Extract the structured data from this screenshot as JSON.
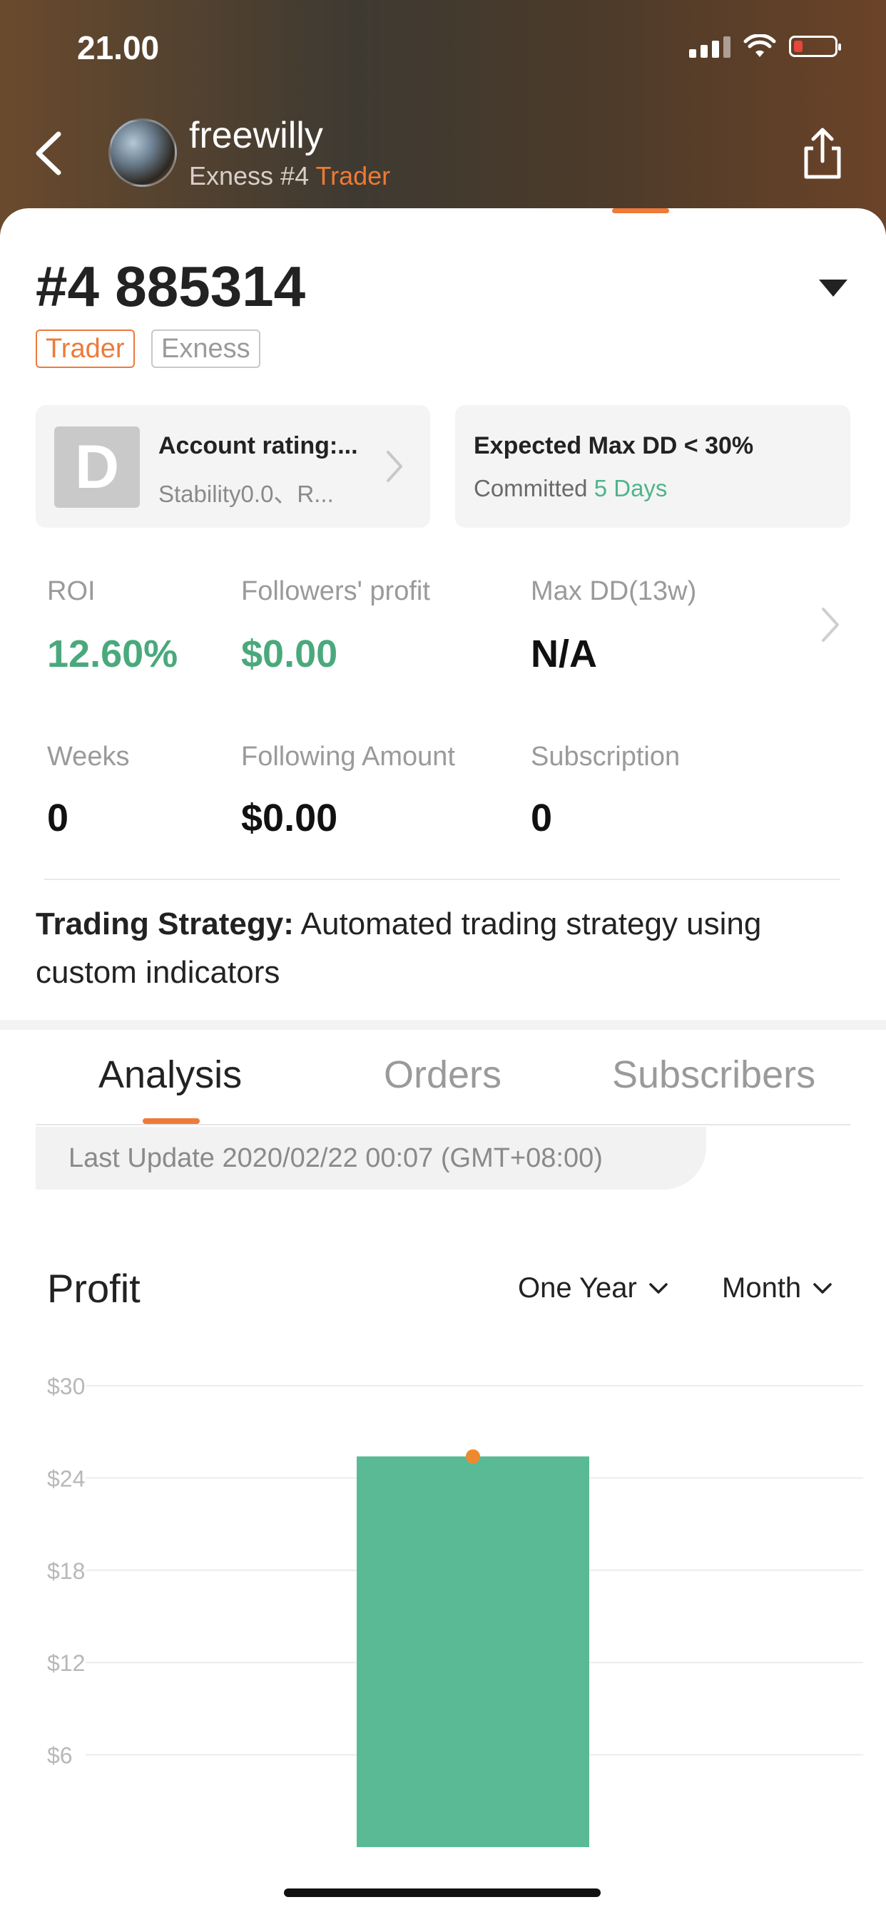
{
  "status": {
    "time": "21.00"
  },
  "header": {
    "username": "freewilly",
    "subtitle_prefix": "Exness #4",
    "subtitle_accent": "Trader",
    "accent_color": "#f07a33"
  },
  "account": {
    "title": "#4 885314",
    "tags": [
      "Trader",
      "Exness"
    ],
    "rating": {
      "logo_letter": "D",
      "title": "Account rating:...",
      "subtitle": "Stability0.0、R..."
    },
    "dd_card": {
      "title": "Expected Max DD < 30%",
      "committed_label": "Committed",
      "committed_value": "5 Days"
    }
  },
  "metrics": [
    {
      "label": "ROI",
      "value": "12.60%"
    },
    {
      "label": "Followers' profit",
      "value": "$0.00"
    },
    {
      "label": "Max DD(13w)",
      "value": "N/A"
    },
    {
      "label": "Weeks",
      "value": "0"
    },
    {
      "label": "Following Amount",
      "value": "$0.00"
    },
    {
      "label": "Subscription",
      "value": "0"
    }
  ],
  "strategy": {
    "label": "Trading Strategy:",
    "text": " Automated trading strategy using custom indicators"
  },
  "tabs": [
    "Analysis",
    "Orders",
    "Subscribers"
  ],
  "last_update": "Last Update 2020/02/22 00:07 (GMT+08:00)",
  "profit": {
    "title": "Profit",
    "range_select": "One Year",
    "period_select": "Month"
  },
  "colors": {
    "accent": "#ee7a3a",
    "green": "#4aa97c",
    "bar": "#5bba96",
    "point": "#ee8a2e"
  },
  "icons": [
    "back-arrow-icon",
    "share-icon",
    "dropdown-caret-icon",
    "chevron-right-icon",
    "chevron-down-icon",
    "wifi-icon",
    "signal-icon",
    "battery-icon"
  ],
  "chart_data": {
    "type": "bar",
    "categories": [
      ""
    ],
    "values": [
      25.4
    ],
    "point_values": [
      25.4
    ],
    "ylim": [
      0,
      30
    ],
    "yticks": [
      "$6",
      "$12",
      "$18",
      "$24",
      "$30"
    ],
    "ytick_values": [
      6,
      12,
      18,
      24,
      30
    ],
    "grid": true,
    "title": "Profit"
  }
}
